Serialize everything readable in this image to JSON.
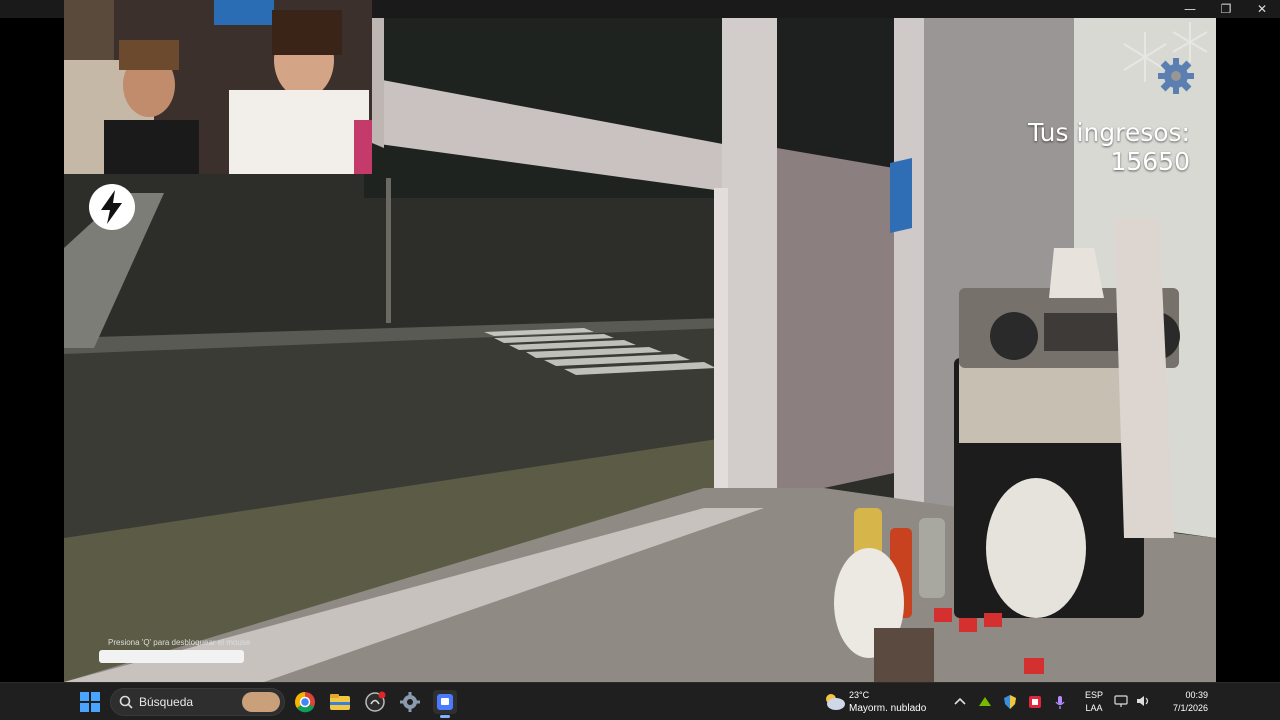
{
  "window": {
    "controls": {
      "minimize": "—",
      "restore": "❐",
      "close": "✕"
    }
  },
  "hud": {
    "income_label": "Tus ingresos: 15650",
    "unlock_hint": "Presiona 'Q' para desbloquear el mouse",
    "icons": [
      "settings-gear-icon",
      "lightning-bolt-icon",
      "snowflake-icon"
    ]
  },
  "taskbar": {
    "search_placeholder": "Búsqueda",
    "apps": [
      "windows-start-icon",
      "chrome-icon",
      "file-explorer-icon",
      "github-desktop-icon",
      "settings-icon",
      "streaming-app-icon"
    ],
    "weather": {
      "temperature": "23°C",
      "description": "Mayorm. nublado"
    },
    "language": {
      "line1": "ESP",
      "line2": "LAA"
    },
    "clock": {
      "time": "00:39",
      "date": "7/1/2026"
    }
  },
  "colors": {
    "taskbar_bg": "#1f1f1f",
    "hud_text": "#ffffff",
    "accent_blue": "#4a7bff"
  }
}
